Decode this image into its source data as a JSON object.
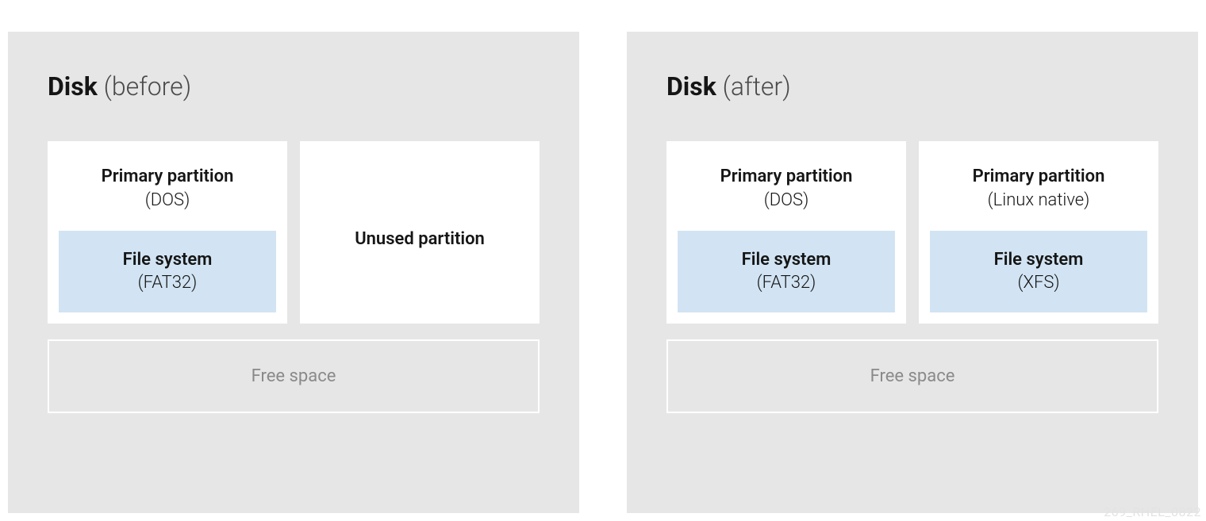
{
  "watermark": "269_RHEL_0822",
  "before": {
    "title_bold": "Disk",
    "title_light": " (before)",
    "partitions": [
      {
        "label_bold": "Primary partition",
        "label_light": "(DOS)",
        "fs_bold": "File system",
        "fs_light": "(FAT32)"
      },
      {
        "unused_label": "Unused partition"
      }
    ],
    "freespace": "Free space"
  },
  "after": {
    "title_bold": "Disk",
    "title_light": " (after)",
    "partitions": [
      {
        "label_bold": "Primary partition",
        "label_light": "(DOS)",
        "fs_bold": "File system",
        "fs_light": "(FAT32)"
      },
      {
        "label_bold": "Primary partition",
        "label_light": "(Linux native)",
        "fs_bold": "File system",
        "fs_light": "(XFS)"
      }
    ],
    "freespace": "Free space"
  }
}
